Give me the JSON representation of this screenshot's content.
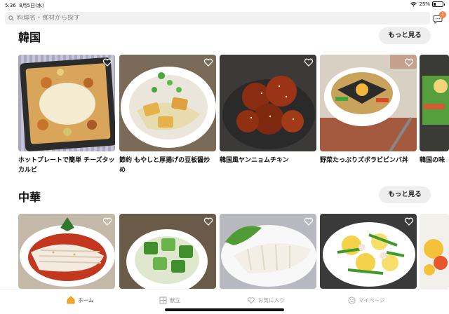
{
  "status": {
    "time": "5:36",
    "date": "8月5日(水)",
    "battery": "25%",
    "battery_level": 0.25
  },
  "search": {
    "placeholder": "料理名・食材から探す"
  },
  "notifications": {
    "badge": "1"
  },
  "sections": [
    {
      "title": "韓国",
      "more_label": "もっと見る",
      "recipes": [
        {
          "title": "ホットプレートで簡単 チーズタッカルビ"
        },
        {
          "title": "節約 もやしと厚揚げの豆板醤炒め"
        },
        {
          "title": "韓国風ヤンニョムチキン"
        },
        {
          "title": "野菜たっぷりズボラビビンバ丼"
        },
        {
          "title": "韓国の味"
        }
      ]
    },
    {
      "title": "中華",
      "more_label": "もっと見る",
      "recipes": [
        {
          "title": ""
        },
        {
          "title": ""
        },
        {
          "title": ""
        },
        {
          "title": ""
        },
        {
          "title": ""
        }
      ]
    }
  ],
  "tabs": [
    {
      "label": "ホーム",
      "icon": "home-icon"
    },
    {
      "label": "献立",
      "icon": "menu-icon"
    },
    {
      "label": "お気に入り",
      "icon": "heart-icon"
    },
    {
      "label": "マイページ",
      "icon": "smile-icon"
    }
  ],
  "colors": {
    "accent": "#f0824a",
    "home_icon": "#f5a623"
  }
}
